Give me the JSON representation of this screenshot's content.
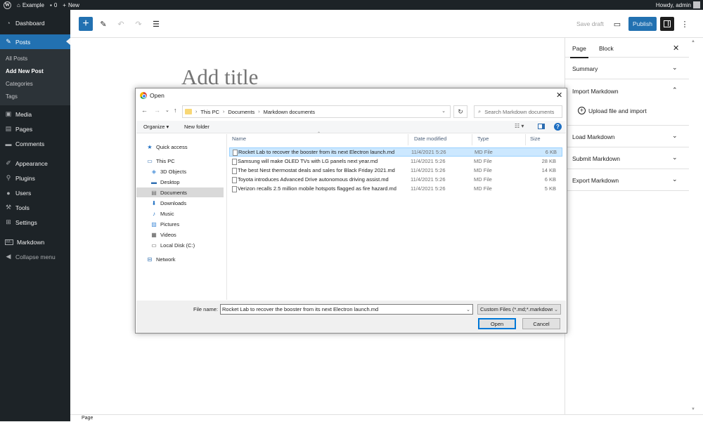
{
  "adminbar": {
    "site_name": "Example",
    "comments_count": "0",
    "new_label": "New",
    "howdy": "Howdy, admin"
  },
  "sidebar": {
    "items": [
      {
        "label": "Dashboard",
        "icon": "dashboard-icon"
      },
      {
        "label": "Posts",
        "icon": "pin-icon"
      },
      {
        "label": "Media",
        "icon": "media-icon"
      },
      {
        "label": "Pages",
        "icon": "page-icon"
      },
      {
        "label": "Comments",
        "icon": "comment-icon"
      },
      {
        "label": "Appearance",
        "icon": "brush-icon"
      },
      {
        "label": "Plugins",
        "icon": "plug-icon"
      },
      {
        "label": "Users",
        "icon": "user-icon"
      },
      {
        "label": "Tools",
        "icon": "wrench-icon"
      },
      {
        "label": "Settings",
        "icon": "settings-icon"
      },
      {
        "label": "Markdown",
        "icon": "markdown-icon"
      },
      {
        "label": "Collapse menu",
        "icon": "collapse-icon"
      }
    ],
    "posts_submenu": [
      "All Posts",
      "Add New Post",
      "Categories",
      "Tags"
    ]
  },
  "editor": {
    "save_draft": "Save draft",
    "publish": "Publish",
    "title_placeholder": "Add title",
    "status_label": "Page"
  },
  "settings_panel": {
    "tab_page": "Page",
    "tab_block": "Block",
    "summary": "Summary",
    "import_markdown": "Import Markdown",
    "upload_label": "Upload file and import",
    "load_markdown": "Load Markdown",
    "submit_markdown": "Submit Markdown",
    "export_markdown": "Export Markdown"
  },
  "dialog": {
    "title": "Open",
    "breadcrumb": [
      "This PC",
      "Documents",
      "Markdown documents"
    ],
    "search_placeholder": "Search Markdown documents",
    "organize": "Organize",
    "new_folder": "New folder",
    "nav": [
      {
        "label": "Quick access",
        "icon": "star-icon"
      },
      {
        "label": "This PC",
        "icon": "computer-icon"
      },
      {
        "label": "3D Objects",
        "icon": "cube-icon"
      },
      {
        "label": "Desktop",
        "icon": "desktop-icon"
      },
      {
        "label": "Documents",
        "icon": "documents-icon"
      },
      {
        "label": "Downloads",
        "icon": "download-icon"
      },
      {
        "label": "Music",
        "icon": "music-icon"
      },
      {
        "label": "Pictures",
        "icon": "pictures-icon"
      },
      {
        "label": "Videos",
        "icon": "video-icon"
      },
      {
        "label": "Local Disk (C:)",
        "icon": "disk-icon"
      },
      {
        "label": "Network",
        "icon": "network-icon"
      }
    ],
    "columns": {
      "name": "Name",
      "date": "Date modified",
      "type": "Type",
      "size": "Size"
    },
    "files": [
      {
        "name": "Rocket Lab to recover the booster from its next Electron launch.md",
        "date": "11/4/2021 5:26",
        "type": "MD File",
        "size": "6 KB"
      },
      {
        "name": "Samsung will make OLED TVs with LG panels next year.md",
        "date": "11/4/2021 5:26",
        "type": "MD File",
        "size": "28 KB"
      },
      {
        "name": "The best Nest thermostat deals and sales for Black Friday 2021.md",
        "date": "11/4/2021 5:26",
        "type": "MD File",
        "size": "14 KB"
      },
      {
        "name": "Toyota introduces Advanced Drive autonomous driving assist.md",
        "date": "11/4/2021 5:26",
        "type": "MD File",
        "size": "6 KB"
      },
      {
        "name": "Verizon recalls 2.5 million mobile hotspots flagged as fire hazard.md",
        "date": "11/4/2021 5:26",
        "type": "MD File",
        "size": "5 KB"
      }
    ],
    "file_name_label": "File name:",
    "file_name_value": "Rocket Lab to recover the booster from its next Electron launch.md",
    "filter": "Custom Files (*.md;*.markdown)",
    "open": "Open",
    "cancel": "Cancel"
  },
  "colors": {
    "accent": "#2271b1",
    "admin_dark": "#1d2327",
    "selection": "#cce8ff"
  }
}
